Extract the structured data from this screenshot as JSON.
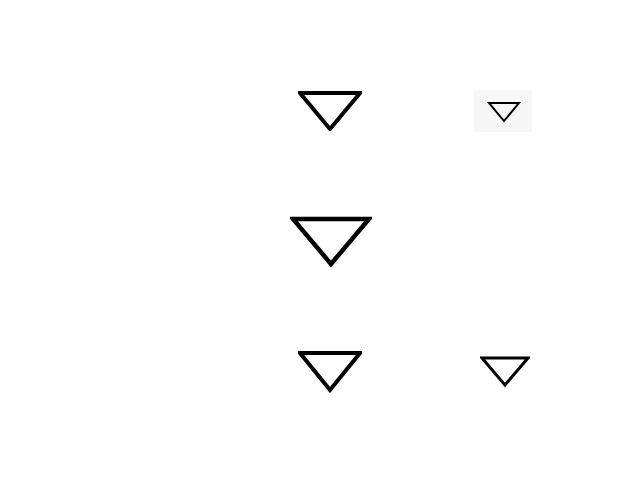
{
  "icons": [
    {
      "name": "chevron-down-icon",
      "style": "outline-triangle-down",
      "color": "#000000"
    },
    {
      "name": "chevron-down-icon",
      "style": "outline-triangle-down",
      "color": "#000000",
      "tile_color": "#f7f7f7"
    },
    {
      "name": "chevron-down-icon",
      "style": "outline-triangle-down",
      "color": "#000000"
    },
    {
      "name": "chevron-down-icon",
      "style": "outline-triangle-down",
      "color": "#000000"
    },
    {
      "name": "chevron-down-icon",
      "style": "outline-triangle-down",
      "color": "#000000"
    }
  ],
  "background": "#ffffff"
}
